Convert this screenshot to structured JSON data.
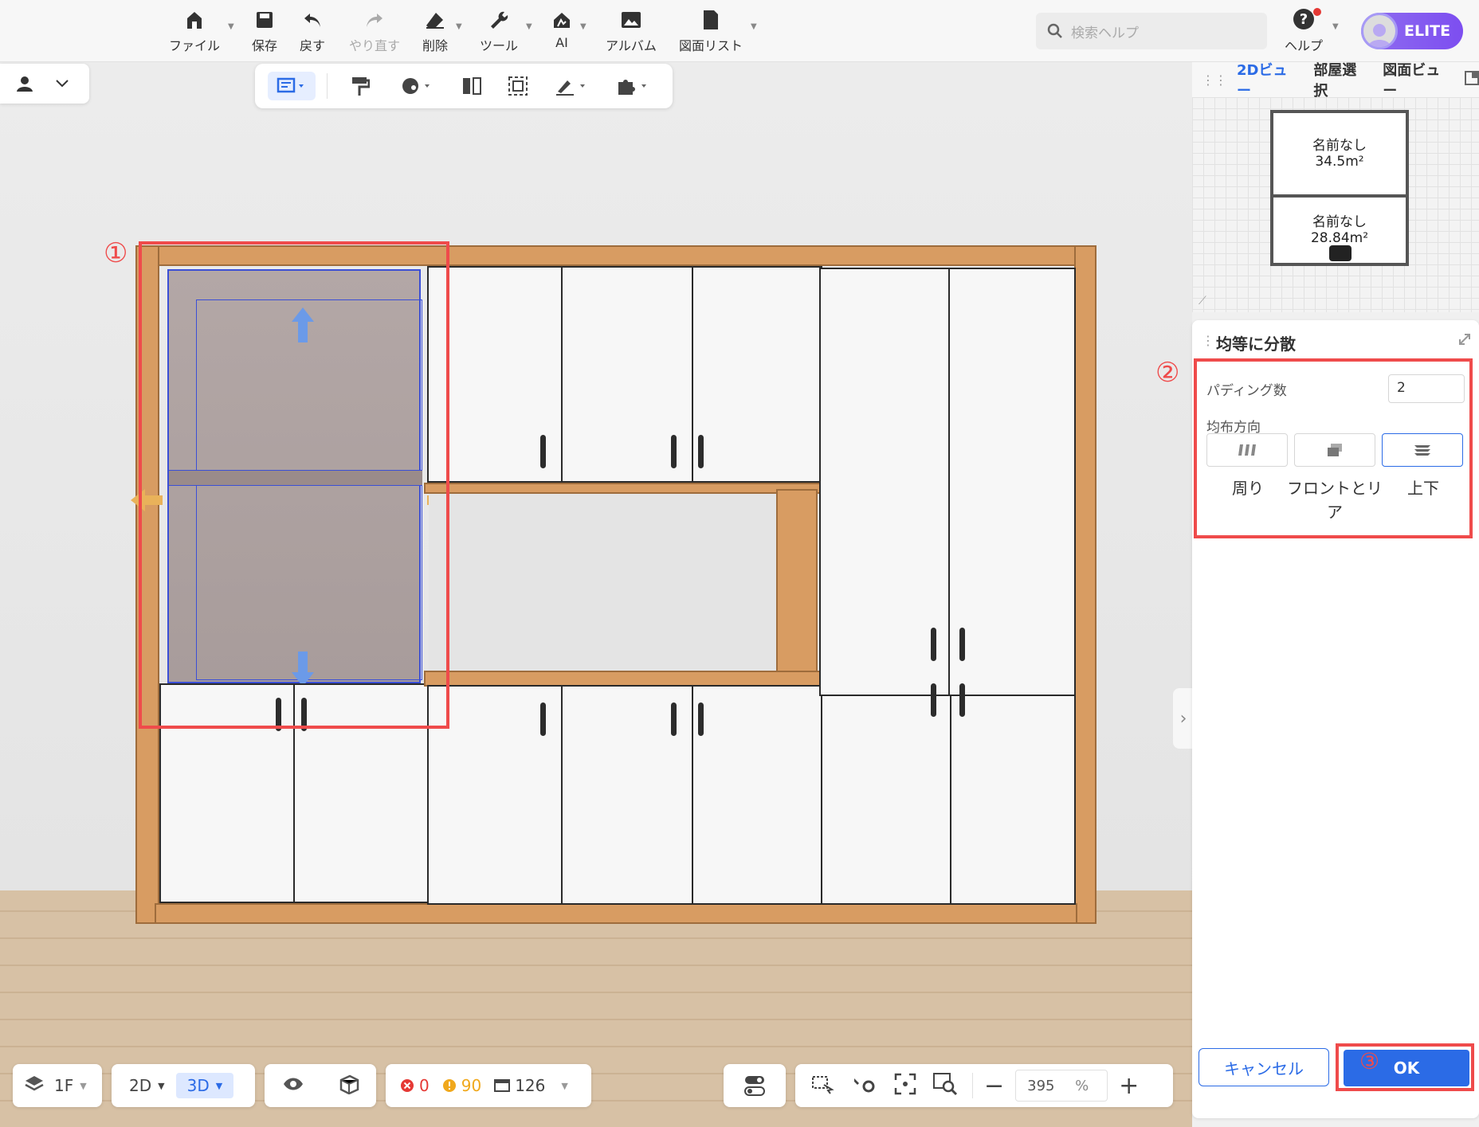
{
  "toolbar": {
    "file": "ファイル",
    "save": "保存",
    "undo": "戻す",
    "redo": "やり直す",
    "delete": "削除",
    "tools": "ツール",
    "ai": "AI",
    "album": "アルバム",
    "drawing_list": "図面リスト"
  },
  "search": {
    "placeholder": "検索ヘルプ"
  },
  "help": {
    "label": "ヘルプ"
  },
  "badge": {
    "label": "ELITE"
  },
  "annotations": {
    "one": "①",
    "two": "②",
    "three": "③"
  },
  "minimap": {
    "tabs": [
      "2Dビュー",
      "部屋選択",
      "図面ビュー"
    ],
    "rooms": [
      {
        "name": "名前なし",
        "area": "34.5m²"
      },
      {
        "name": "名前なし",
        "area": "28.84m²"
      }
    ]
  },
  "panel": {
    "title": "均等に分散",
    "padding_label": "パディング数",
    "padding_value": "2",
    "direction_label": "均布方向",
    "directions": [
      "周り",
      "フロントとリア",
      "上下"
    ],
    "active_direction": 2,
    "cancel": "キャンセル",
    "ok": "OK"
  },
  "bottom": {
    "floor": "1F",
    "view_2d": "2D",
    "view_3d": "3D",
    "errors": "0",
    "warnings": "90",
    "items": "126",
    "zoom": "395",
    "zoom_unit": "%"
  },
  "colors": {
    "accent": "#2b6be6",
    "annotation": "#ef4b4b",
    "wood": "#d89c62"
  }
}
